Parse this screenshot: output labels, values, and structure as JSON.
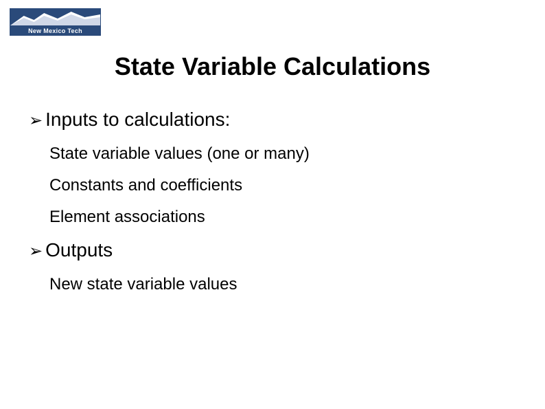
{
  "logo": {
    "text": "New Mexico Tech"
  },
  "title": "State Variable Calculations",
  "sections": [
    {
      "heading": "Inputs to calculations:",
      "items": [
        "State variable values (one or many)",
        "Constants and coefficients",
        "Element associations"
      ]
    },
    {
      "heading": "Outputs",
      "items": [
        "New state variable values"
      ]
    }
  ]
}
